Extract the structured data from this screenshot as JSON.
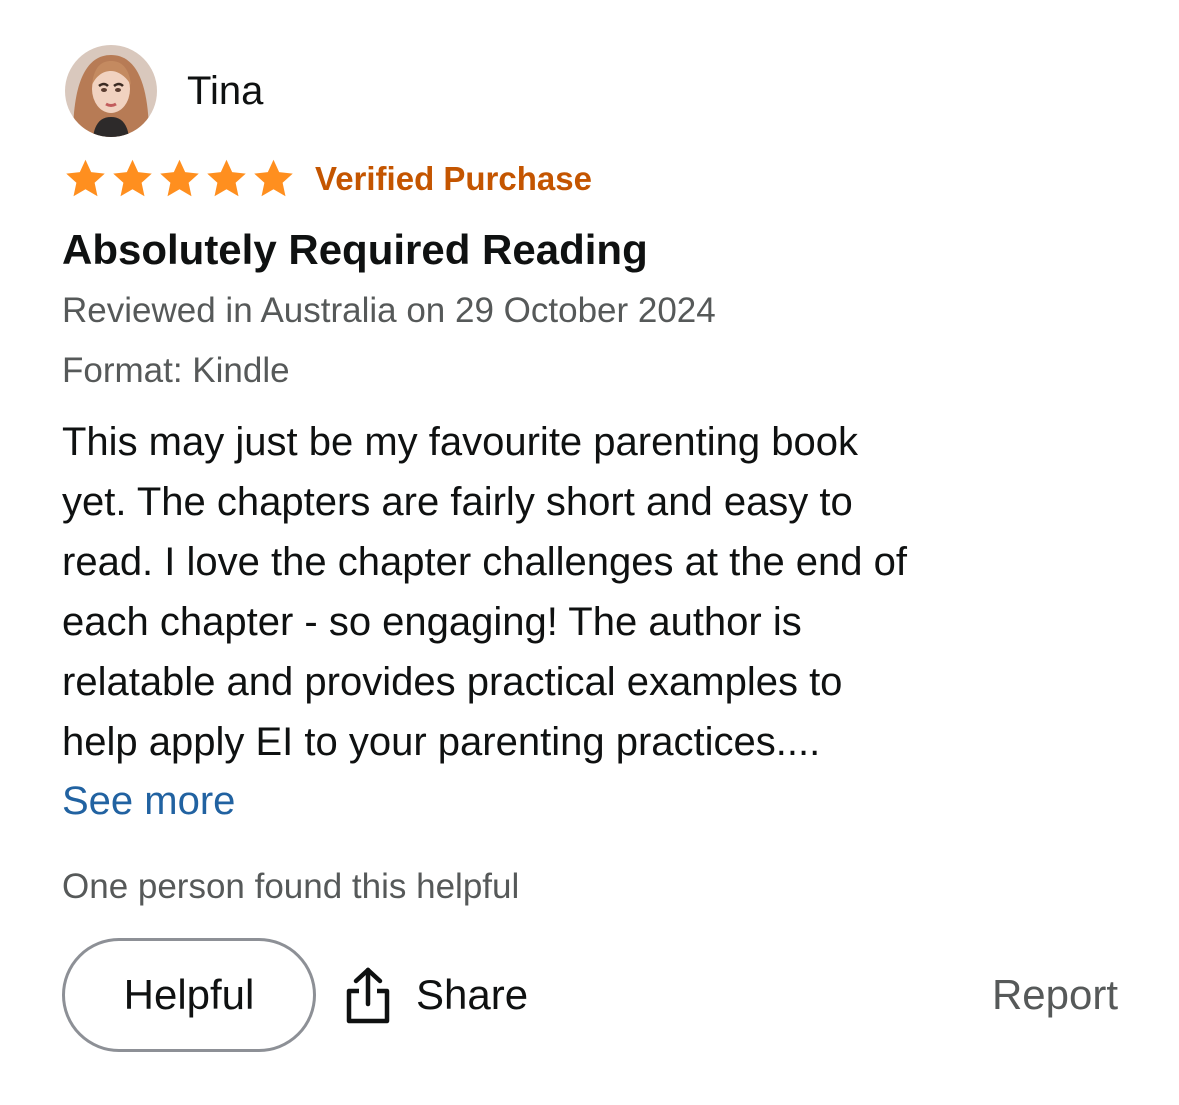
{
  "review": {
    "reviewer_name": "Tina",
    "rating": 5,
    "rating_max": 5,
    "star_color": "#ff8f1f",
    "verified_label": "Verified Purchase",
    "title": "Absolutely Required Reading",
    "date_line": "Reviewed in Australia on 29 October 2024",
    "format_line": "Format: Kindle",
    "body_lines": [
      "This may just be my favourite parenting book",
      "yet. The chapters are fairly short and easy to",
      "read. I love the chapter challenges at the end of",
      "each chapter - so engaging! The author is",
      "relatable and provides practical examples to",
      "help apply EI to your parenting practices...."
    ],
    "see_more_label": "See more",
    "helpful_count_text": "One person found this helpful"
  },
  "actions": {
    "helpful_label": "Helpful",
    "share_label": "Share",
    "report_label": "Report",
    "share_icon": "share-icon"
  },
  "colors": {
    "verified": "#c45500",
    "link": "#2162a1",
    "secondary_text": "#565959",
    "button_border": "#8d9096"
  }
}
